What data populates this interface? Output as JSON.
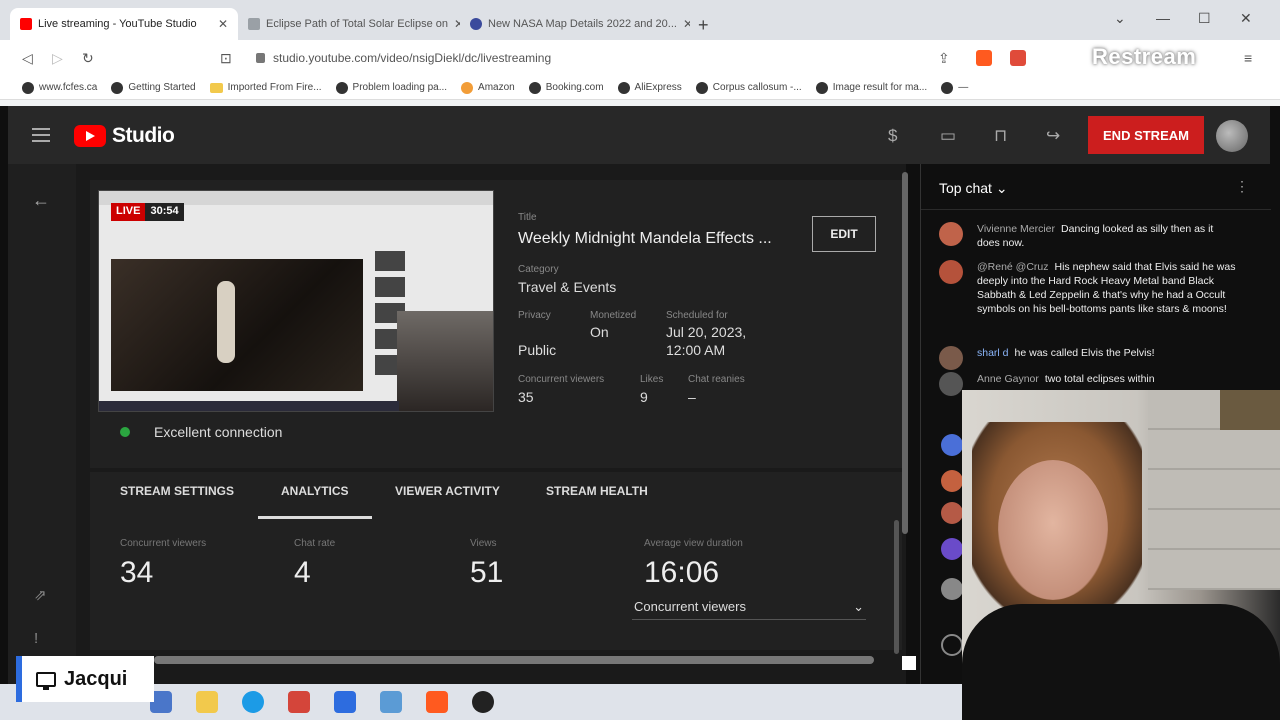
{
  "browser": {
    "tabs": [
      {
        "label": "Live streaming - YouTube Studio",
        "color": "#ff0000"
      },
      {
        "label": "Eclipse Path of Total Solar Eclipse on",
        "color": "#9aa0a6"
      },
      {
        "label": "New NASA Map Details 2022 and 20...",
        "color": "#3b4a9c"
      }
    ],
    "url": "studio.youtube.com/video/nsigDiekl/dc/livestreaming",
    "bookmarks": [
      "www.fcfes.ca",
      "Getting Started",
      "Imported From Fire...",
      "Problem loading pa...",
      "Amazon",
      "Booking.com",
      "AliExpress",
      "Corpus callosum -...",
      "Image result for ma...",
      "—"
    ],
    "overlay_brand": "Restream"
  },
  "studio": {
    "brand": "Studio",
    "end_stream_label": "END STREAM"
  },
  "stream": {
    "live_label": "LIVE",
    "live_time": "30:54",
    "title_label": "Title",
    "title": "Weekly Midnight Mandela Effects ...",
    "edit_label": "EDIT",
    "category_label": "Category",
    "category": "Travel & Events",
    "privacy_label": "Privacy",
    "privacy": "Public",
    "monetized_label": "Monetized",
    "monetized": "On",
    "scheduled_label": "Scheduled for",
    "scheduled_date": "Jul 20, 2023,",
    "scheduled_time": "12:00 AM",
    "viewers_label": "Concurrent viewers",
    "viewers": "35",
    "likes_label": "Likes",
    "likes": "9",
    "chat_rate_label": "Chat reanies",
    "chat_rate": "–",
    "connection": "Excellent connection",
    "connection_color": "#2ba640"
  },
  "tabs": [
    "STREAM SETTINGS",
    "ANALYTICS",
    "VIEWER ACTIVITY",
    "STREAM HEALTH"
  ],
  "analytics": {
    "concurrent_label": "Concurrent viewers",
    "concurrent": "34",
    "chat_rate_label": "Chat rate",
    "chat_rate": "4",
    "views_label": "Views",
    "views": "51",
    "avg_label": "Average view duration",
    "avg": "16:06",
    "select_value": "Concurrent viewers"
  },
  "chat": {
    "header": "Top chat",
    "messages": [
      {
        "author": "Vivienne Mercier",
        "text": "Dancing looked as silly then as it does now.",
        "color": "#c0634a"
      },
      {
        "author": "@René @Cruz",
        "text": "His nephew said that Elvis said he was deeply into the Hard Rock Heavy Metal band Black Sabbath & Led Zeppelin & that's why he had a Occult symbols on his bell-bottoms pants like stars & moons!",
        "color": "#b5523b"
      },
      {
        "author": "sharl d",
        "text": "he was called Elvis the Pelvis!",
        "color": "#7a5a4a"
      },
      {
        "author": "Anne Gaynor",
        "text": "two total eclipses within",
        "color": "#555555"
      }
    ]
  },
  "presenter": {
    "name": "Jacqui"
  }
}
